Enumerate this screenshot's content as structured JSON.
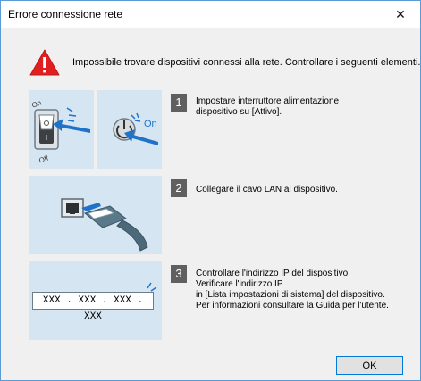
{
  "window": {
    "title": "Errore connessione rete",
    "close_glyph": "✕"
  },
  "message": "Impossibile trovare dispositivi connessi alla rete. Controllare i seguenti elementi.",
  "steps": [
    {
      "number": "1",
      "lines": [
        "Impostare interruttore alimentazione",
        "dispositivo su [Attivo]."
      ],
      "switch_on_label": "On",
      "switch_off_label": "Off",
      "button_on_label": "On"
    },
    {
      "number": "2",
      "lines": [
        "Collegare il cavo LAN al dispositivo."
      ]
    },
    {
      "number": "3",
      "lines": [
        "Controllare l'indirizzo IP del dispositivo.",
        "Verificare l'indirizzo IP",
        "in [Lista impostazioni di sistema] del dispositivo.",
        "Per informazioni consultare la Guida per l'utente."
      ],
      "ip_display": "XXX . XXX . XXX . XXX"
    }
  ],
  "ok_label": "OK",
  "colors": {
    "panel": "#d6e5f2",
    "accent_blue": "#1e73c9",
    "warning_red": "#e02020",
    "step_badge": "#606060"
  },
  "icons": {
    "warning": "warning-icon",
    "close": "close-icon"
  }
}
